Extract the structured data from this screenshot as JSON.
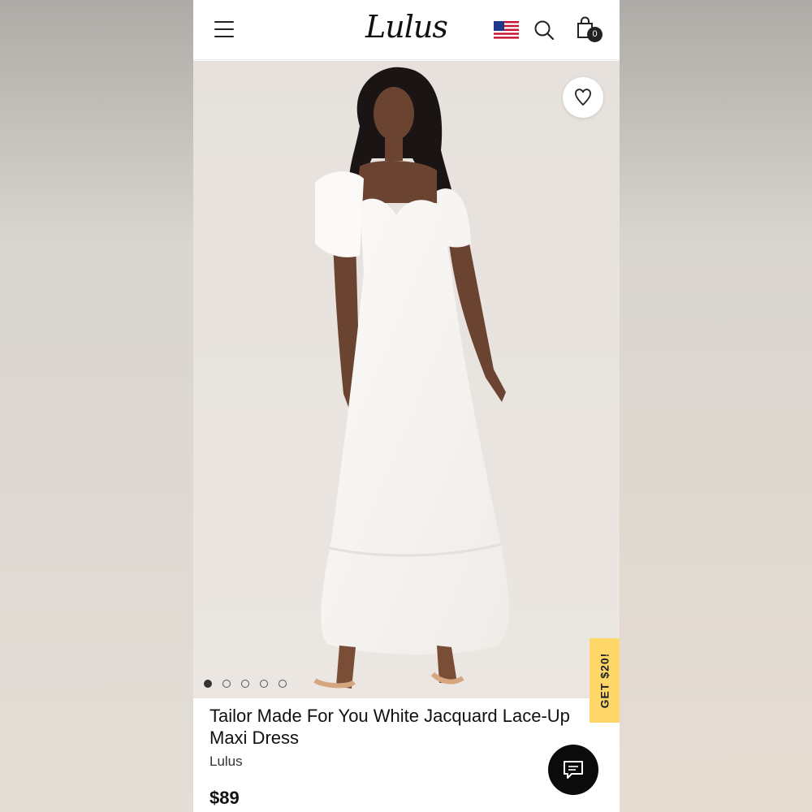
{
  "header": {
    "logo_text": "Lulus",
    "cart_count": "0",
    "icons": [
      "menu-icon",
      "us-flag-icon",
      "search-icon",
      "shopping-bag-icon"
    ]
  },
  "gallery": {
    "image_count": 5,
    "active_index": 0,
    "promo_tab": "GET $20!",
    "wishlist_icon": "heart-icon"
  },
  "product": {
    "title": "Tailor Made For You White Jacquard Lace-Up Maxi Dress",
    "brand": "Lulus",
    "price": "$89"
  },
  "chat": {
    "icon": "chat-bubble-icon"
  },
  "colors": {
    "promo": "#ffd768",
    "chat": "#0b0b0b",
    "text": "#111111"
  }
}
